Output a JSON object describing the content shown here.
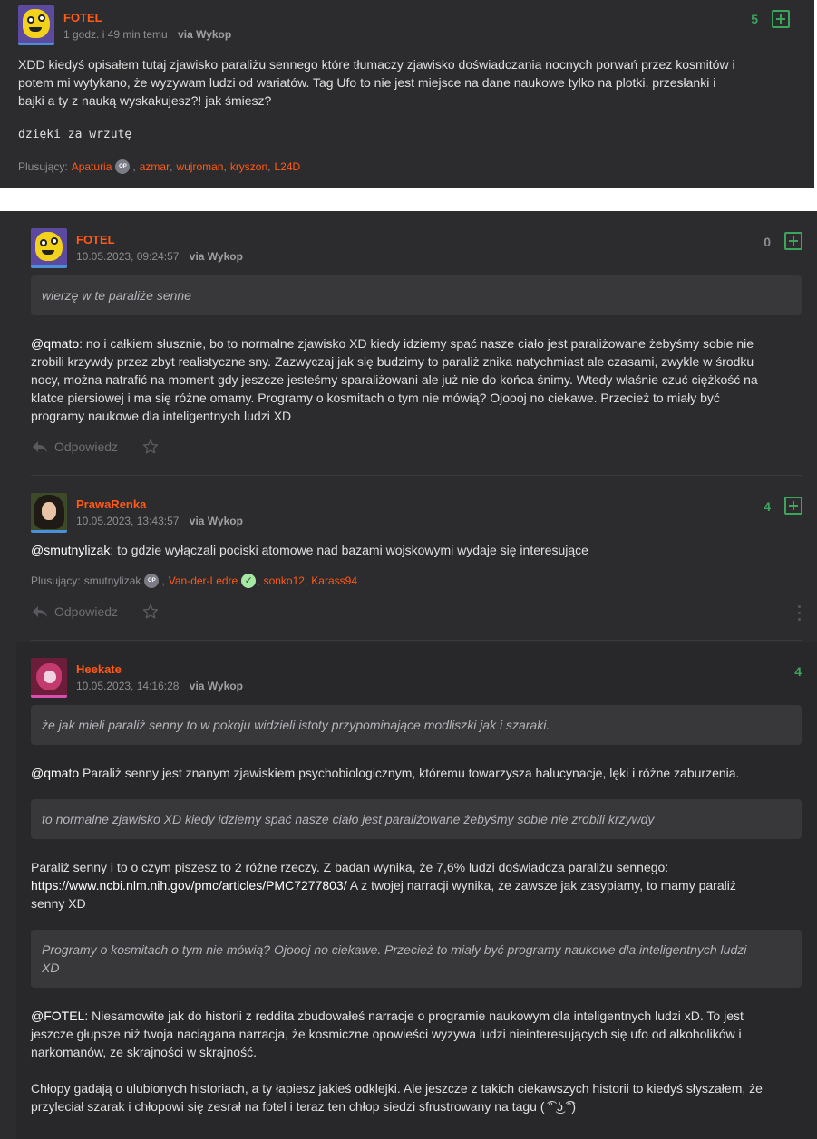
{
  "top_entry": {
    "author": "FOTEL",
    "time": "1 godz. i 49 min temu",
    "via": "via Wykop",
    "score": "5",
    "body_line1": "XDD kiedyś opisałem tutaj zjawisko paraliżu sennego które tłumaczy zjawisko doświadczania nocnych porwań przez kosmitów i",
    "body_line2": "potem mi wytykano, że wyzywam ludzi od wariatów. Tag Ufo to nie jest miejsce na dane naukowe tylko na plotki, przesłanki i",
    "body_line3": "bajki a ty z nauką wyskakujesz?! jak śmiesz?",
    "mono_text": "dzięki za wrzutę",
    "plusers_label": "Plusujący:",
    "plusers": [
      "Apaturia",
      "azmar",
      "wujroman",
      "kryszon",
      "L24D"
    ],
    "op_badge": "OP"
  },
  "comment1": {
    "author": "FOTEL",
    "time": "10.05.2023, 09:24:57",
    "via": "via Wykop",
    "score": "0",
    "quote": "wierzę w te paraliże senne",
    "mention": "@qmato",
    "body_line1_rest": ": no i całkiem słusznie, bo to normalne zjawisko XD kiedy idziemy spać nasze ciało jest paraliżowane żebyśmy sobie nie",
    "body_line2": "zrobili krzywdy przez zbyt realistyczne sny. Zazwyczaj jak się budzimy to paraliż znika natychmiast ale czasami, zwykle w środku",
    "body_line3": "nocy, można natrafić na moment gdy jeszcze jesteśmy sparaliżowani ale już nie do końca śnimy. Wtedy właśnie czuć ciężkość na",
    "body_line4": "klatce piersiowej i ma się różne omamy. Programy o kosmitach o tym nie mówią? Ojoooj no ciekawe. Przecież to miały być",
    "body_line5": "programy naukowe dla inteligentnych ludzi XD",
    "reply_label": "Odpowiedz"
  },
  "comment2": {
    "author": "PrawaRenka",
    "time": "10.05.2023, 13:43:57",
    "via": "via Wykop",
    "score": "4",
    "mention": "@smutnylizak",
    "body_rest": ": to gdzie wyłączali pociski atomowe nad bazami wojskowymi wydaje się interesujące",
    "plusers_label": "Plusujący:",
    "plusers_first": "smutnylizak",
    "op_badge": "OP",
    "plusers_second": "Van-der-Ledre",
    "check_badge": "✓",
    "plusers_rest": [
      "sonko12",
      "Karass94"
    ],
    "reply_label": "Odpowiedz"
  },
  "comment3": {
    "author": "Heekate",
    "time": "10.05.2023, 14:16:28",
    "via": "via Wykop",
    "score": "4",
    "quote1": "że jak mieli paraliż senny to w pokoju widzieli istoty przypominające modliszki jak i szaraki.",
    "mention1": "@qmato",
    "body1_rest": " Paraliż senny jest znanym zjawiskiem psychobiologicznym, któremu towarzysza halucynacje, lęki i różne zaburzenia.",
    "quote2": "to normalne zjawisko XD kiedy idziemy spać nasze ciało jest paraliżowane żebyśmy sobie nie zrobili krzywdy",
    "body2_line1": "Paraliż senny i to o czym piszesz to 2 różne rzeczy. Z badan wynika, że 7,6% ludzi doświadcza paraliżu sennego:",
    "body2_link": "https://www.ncbi.nlm.nih.gov/pmc/articles/PMC7277803/",
    "body2_line2_rest": " A z twojej narracji wynika, że zawsze jak zasypiamy, to mamy paraliż",
    "body2_line3": "senny XD",
    "quote3_line1": "Programy o kosmitach o tym nie mówią? Ojoooj no ciekawe. Przecież to miały być programy naukowe dla inteligentnych ludzi",
    "quote3_line2": "XD",
    "mention2": "@FOTEL",
    "body3_line1_rest": ": Niesamowite jak do historii z reddita zbudowałeś narracje o programie naukowym dla inteligentnych ludzi xD. To jest",
    "body3_line2": "jeszcze głupsze niż twoja naciągana narracja, że kosmiczne opowieści wyzywa ludzi nieinteresujących się ufo od alkoholików i",
    "body3_line3": "narkomanów, ze skrajności w skrajność.",
    "body4_line1": "Chłopy gadają o ulubionych historiach, a ty łapiesz jakieś odklejki. Ale jeszcze z takich ciekawszych historii to kiedyś słyszałem, że",
    "body4_line2": "przyleciał szarak i chłopowi się zesrał na fotel i teraz ten chłop siedzi sfrustrowany na tagu ( ͡° ͜ʖ ͡°)"
  }
}
